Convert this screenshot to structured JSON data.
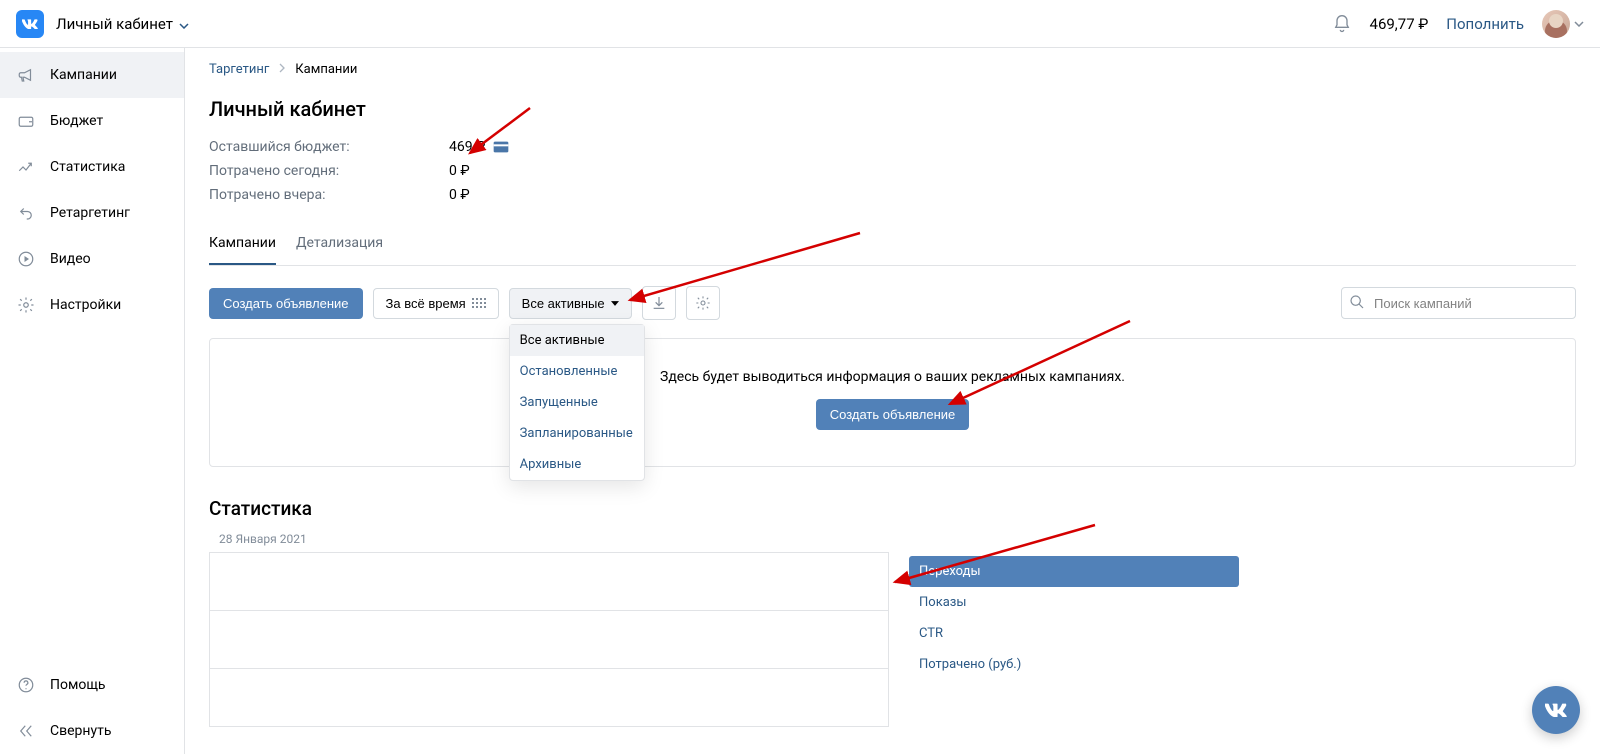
{
  "header": {
    "account_label": "Личный кабинет",
    "balance": "469,77 ₽",
    "topup_label": "Пополнить"
  },
  "sidebar": {
    "items": [
      {
        "label": "Кампании",
        "active": true
      },
      {
        "label": "Бюджет"
      },
      {
        "label": "Статистика"
      },
      {
        "label": "Ретаргетинг"
      },
      {
        "label": "Видео"
      },
      {
        "label": "Настройки"
      }
    ],
    "footer": [
      {
        "label": "Помощь"
      },
      {
        "label": "Свернуть"
      }
    ]
  },
  "breadcrumb": {
    "root": "Таргетинг",
    "current": "Кампании"
  },
  "page": {
    "title": "Личный кабинет",
    "budget_rows": [
      {
        "label": "Оставшийся бюджет:",
        "value": "469 ₽",
        "card": true
      },
      {
        "label": "Потрачено сегодня:",
        "value": "0 ₽"
      },
      {
        "label": "Потрачено вчера:",
        "value": "0 ₽"
      }
    ]
  },
  "tabs": {
    "items": [
      "Кампании",
      "Детализация"
    ],
    "active": 0
  },
  "toolbar": {
    "create_label": "Создать объявление",
    "period_label": "За всё время",
    "filter_label": "Все активные",
    "filter_options": [
      "Все активные",
      "Остановленные",
      "Запущенные",
      "Запланированные",
      "Архивные"
    ],
    "search_placeholder": "Поиск кампаний"
  },
  "banner": {
    "text": "Здесь будет выводиться информация о ваших рекламных кампаниях.",
    "cta": "Создать объявление"
  },
  "stats": {
    "title": "Статистика",
    "date": "28 Января 2021",
    "metrics": [
      {
        "label": "Переходы",
        "active": true
      },
      {
        "label": "Показы"
      },
      {
        "label": "CTR"
      },
      {
        "label": "Потрачено (руб.)"
      }
    ]
  }
}
